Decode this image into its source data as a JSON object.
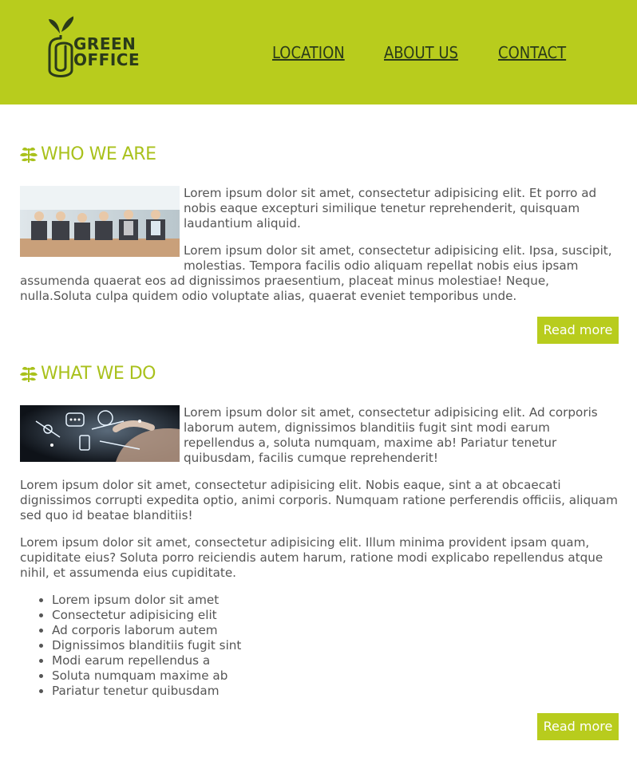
{
  "brand": {
    "line1": "GREEN",
    "line2": "OFFICE",
    "logo_icon": "paperclip-sprout-icon"
  },
  "nav": [
    "LOCATION",
    "ABOUT US",
    "CONTACT"
  ],
  "sections": [
    {
      "title": "WHO WE ARE",
      "icon": "leaf-icon",
      "paragraphs": [
        "Lorem ipsum dolor sit amet, consectetur adipisicing elit. Et porro ad nobis eaque excepturi similique tenetur reprehenderit, quisquam laudantium aliquid.",
        "Lorem ipsum dolor sit amet, consectetur adipisicing elit. Ipsa, suscipit, molestias. Tempora facilis odio aliquam repellat nobis eius ipsam assumenda quaerat eos ad dignissimos praesentium, placeat minus molestiae! Neque, nulla.Soluta culpa quidem odio voluptate alias, quaerat eveniet temporibus unde."
      ],
      "button": "Read more"
    },
    {
      "title": "WHAT WE DO",
      "icon": "leaf-icon",
      "paragraphs": [
        "Lorem ipsum dolor sit amet, consectetur adipisicing elit. Ad corporis laborum autem, dignissimos blanditiis fugit sint modi earum repellendus a, soluta numquam, maxime ab! Pariatur tenetur quibusdam, facilis cumque reprehenderit!",
        "Lorem ipsum dolor sit amet, consectetur adipisicing elit. Nobis eaque, sint a at obcaecati dignissimos corrupti expedita optio, animi corporis. Numquam ratione perferendis officiis, aliquam sed quo id beatae blanditiis!",
        "Lorem ipsum dolor sit amet, consectetur adipisicing elit. Illum minima provident ipsam quam, cupiditate eius? Soluta porro reiciendis autem harum, ratione modi explicabo repellendus atque nihil, et assumenda eius cupiditate."
      ],
      "list": [
        "Lorem ipsum dolor sit amet",
        "Consectetur adipisicing elit",
        "Ad corporis laborum autem",
        "Dignissimos blanditiis fugit sint",
        "Modi earum repellendus a",
        "Soluta numquam maxime ab",
        "Pariatur tenetur quibusdam"
      ],
      "button": "Read more"
    }
  ],
  "colors": {
    "accent": "#b8cc1d",
    "heading": "#a9c11c",
    "text": "#555555",
    "dark": "#2a3a1a"
  }
}
